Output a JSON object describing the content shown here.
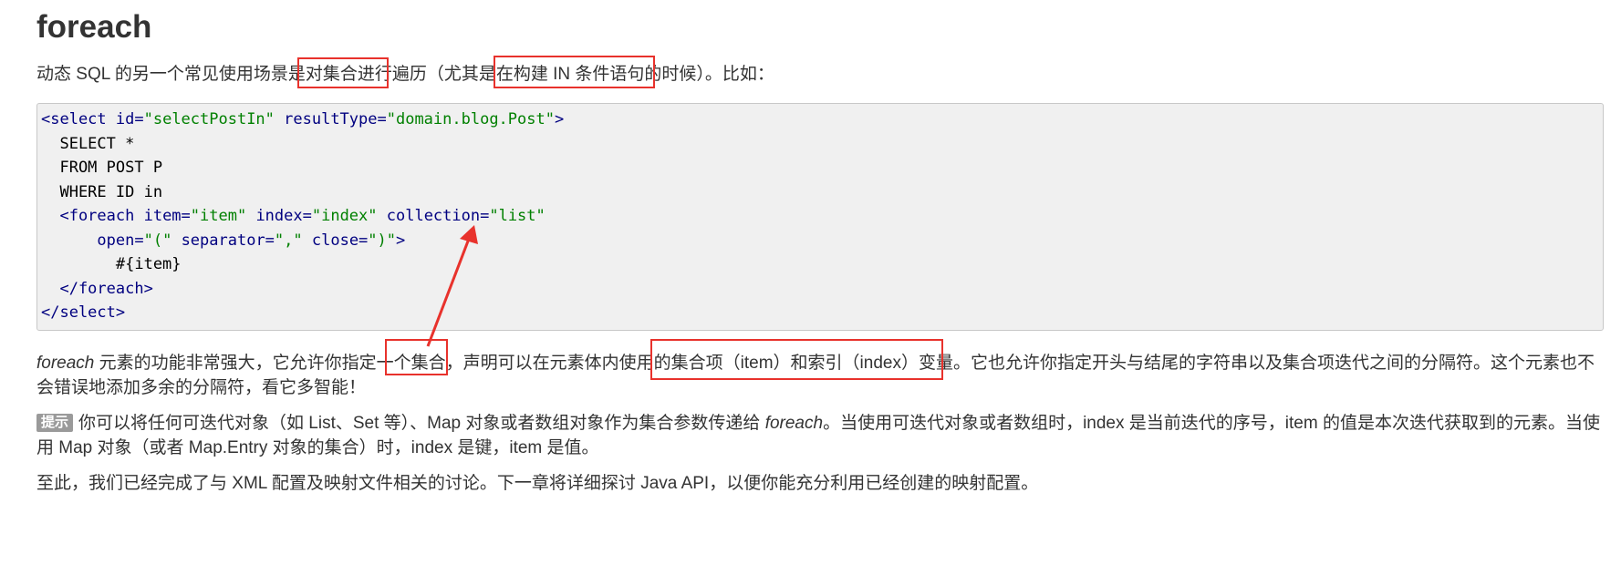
{
  "heading": "foreach",
  "intro_text": "动态 SQL 的另一个常见使用场景是对集合进行遍历（尤其是在构建 IN 条件语句的时候）。比如：",
  "code": {
    "line1": {
      "open": "<select ",
      "a1": "id=",
      "v1": "\"selectPostIn\"",
      "a2": " resultType=",
      "v2": "\"domain.blog.Post\"",
      "close": ">"
    },
    "line2": "  SELECT *",
    "line3": "  FROM POST P",
    "line4": "  WHERE ID in",
    "line5": {
      "open": "  <foreach ",
      "a1": "item=",
      "v1": "\"item\"",
      "a2": " index=",
      "v2": "\"index\"",
      "a3": " collection=",
      "v3": "\"list\""
    },
    "line6": {
      "indent": "      ",
      "a1": "open=",
      "v1": "\"(\"",
      "a2": " separator=",
      "v2": "\",\"",
      "a3": " close=",
      "v3": "\")\"",
      "close": ">"
    },
    "line7": "        #{item}",
    "line8": "  </foreach>",
    "line9": "</select>"
  },
  "body_para": {
    "em": "foreach",
    "rest": " 元素的功能非常强大，它允许你指定一个集合，声明可以在元素体内使用的集合项（item）和索引（index）变量。它也允许你指定开头与结尾的字符串以及集合项迭代之间的分隔符。这个元素也不会错误地添加多余的分隔符，看它多智能！"
  },
  "tip": {
    "badge": "提示",
    "part1": "你可以将任何可迭代对象（如 List、Set 等）、Map 对象或者数组对象作为集合参数传递给 ",
    "em": "foreach",
    "part2": "。当使用可迭代对象或者数组时，index 是当前迭代的序号，item 的值是本次迭代获取到的元素。当使用 Map 对象（或者 Map.Entry 对象的集合）时，index 是键，item 是值。"
  },
  "final_text": "至此，我们已经完成了与 XML 配置及映射文件相关的讨论。下一章将详细探讨 Java API，以便你能充分利用已经创建的映射配置。",
  "colors": {
    "annotation": "#e8322c",
    "tag": "#000080",
    "string": "#008000",
    "code_bg": "#f0f0f0"
  }
}
